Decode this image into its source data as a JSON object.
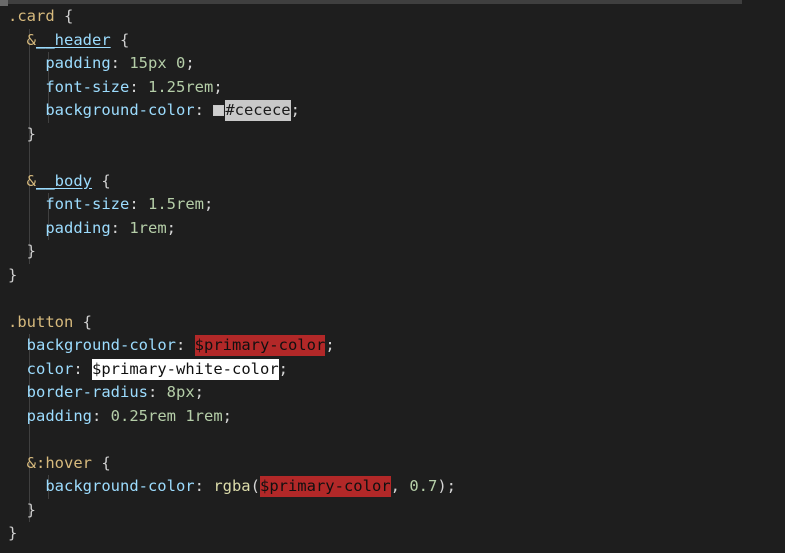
{
  "editor": {
    "language": "scss",
    "theme": "dark-plus",
    "background_color": "#1e1e1e",
    "foreground_color": "#d4d4d4",
    "scrollbar": {
      "name": "horizontal-scrollbar",
      "thumb_color": "#3f3f3f"
    }
  },
  "colors": {
    "selector": "#d7ba7d",
    "property": "#9cdcfe",
    "value": "#b5cea8",
    "function": "#dcdcaa",
    "punctuation": "#d4d4d4",
    "swatch_cecece": "#cecece",
    "highlight_gray": "#c8c8c8",
    "highlight_red": "#b22828",
    "highlight_white": "#ffffff",
    "indent_guide": "#404040"
  },
  "code": {
    "lines": [
      {
        "n": 1,
        "guides": [],
        "segments": [
          {
            "t": ".card",
            "c": "tok-selector"
          },
          {
            "t": " ",
            "c": "tok-plain"
          },
          {
            "t": "{",
            "c": "tok-brace"
          }
        ]
      },
      {
        "n": 2,
        "guides": [
          "g1"
        ],
        "segments": [
          {
            "t": "  ",
            "c": "tok-plain"
          },
          {
            "t": "&",
            "c": "tok-amp"
          },
          {
            "t": "__header",
            "c": "tok-nest"
          },
          {
            "t": " ",
            "c": "tok-plain"
          },
          {
            "t": "{",
            "c": "tok-brace"
          }
        ]
      },
      {
        "n": 3,
        "guides": [
          "g1",
          "g2"
        ],
        "segments": [
          {
            "t": "    ",
            "c": "tok-plain"
          },
          {
            "t": "padding",
            "c": "tok-prop"
          },
          {
            "t": ": ",
            "c": "tok-punct"
          },
          {
            "t": "15px",
            "c": "tok-unitnum"
          },
          {
            "t": " ",
            "c": "tok-plain"
          },
          {
            "t": "0",
            "c": "tok-num"
          },
          {
            "t": ";",
            "c": "tok-punct"
          }
        ]
      },
      {
        "n": 4,
        "guides": [
          "g1",
          "g2"
        ],
        "segments": [
          {
            "t": "    ",
            "c": "tok-plain"
          },
          {
            "t": "font-size",
            "c": "tok-prop"
          },
          {
            "t": ": ",
            "c": "tok-punct"
          },
          {
            "t": "1.25rem",
            "c": "tok-unitnum"
          },
          {
            "t": ";",
            "c": "tok-punct"
          }
        ]
      },
      {
        "n": 5,
        "guides": [
          "g1",
          "g2"
        ],
        "segments": [
          {
            "t": "    ",
            "c": "tok-plain"
          },
          {
            "t": "background-color",
            "c": "tok-prop"
          },
          {
            "t": ": ",
            "c": "tok-punct"
          },
          {
            "t": "",
            "c": "swatch-cecece"
          },
          {
            "t": "#cecece",
            "c": "hl-gray"
          },
          {
            "t": ";",
            "c": "tok-punct"
          }
        ]
      },
      {
        "n": 6,
        "guides": [
          "g1"
        ],
        "segments": [
          {
            "t": "  ",
            "c": "tok-plain"
          },
          {
            "t": "}",
            "c": "tok-brace"
          }
        ]
      },
      {
        "n": 7,
        "guides": [
          "g1"
        ],
        "segments": []
      },
      {
        "n": 8,
        "guides": [
          "g1"
        ],
        "segments": [
          {
            "t": "  ",
            "c": "tok-plain"
          },
          {
            "t": "&",
            "c": "tok-amp"
          },
          {
            "t": "__body",
            "c": "tok-nest"
          },
          {
            "t": " ",
            "c": "tok-plain"
          },
          {
            "t": "{",
            "c": "tok-brace"
          }
        ]
      },
      {
        "n": 9,
        "guides": [
          "g1",
          "g2"
        ],
        "segments": [
          {
            "t": "    ",
            "c": "tok-plain"
          },
          {
            "t": "font-size",
            "c": "tok-prop"
          },
          {
            "t": ": ",
            "c": "tok-punct"
          },
          {
            "t": "1.5rem",
            "c": "tok-unitnum"
          },
          {
            "t": ";",
            "c": "tok-punct"
          }
        ]
      },
      {
        "n": 10,
        "guides": [
          "g1",
          "g2"
        ],
        "segments": [
          {
            "t": "    ",
            "c": "tok-plain"
          },
          {
            "t": "padding",
            "c": "tok-prop"
          },
          {
            "t": ": ",
            "c": "tok-punct"
          },
          {
            "t": "1rem",
            "c": "tok-unitnum"
          },
          {
            "t": ";",
            "c": "tok-punct"
          }
        ]
      },
      {
        "n": 11,
        "guides": [
          "g1"
        ],
        "segments": [
          {
            "t": "  ",
            "c": "tok-plain"
          },
          {
            "t": "}",
            "c": "tok-brace"
          }
        ]
      },
      {
        "n": 12,
        "guides": [],
        "segments": [
          {
            "t": "}",
            "c": "tok-brace"
          }
        ]
      },
      {
        "n": 13,
        "guides": [],
        "segments": []
      },
      {
        "n": 14,
        "guides": [],
        "segments": [
          {
            "t": ".button",
            "c": "tok-selector"
          },
          {
            "t": " ",
            "c": "tok-plain"
          },
          {
            "t": "{",
            "c": "tok-brace"
          }
        ]
      },
      {
        "n": 15,
        "guides": [
          "g1"
        ],
        "segments": [
          {
            "t": "  ",
            "c": "tok-plain"
          },
          {
            "t": "background-color",
            "c": "tok-prop"
          },
          {
            "t": ": ",
            "c": "tok-punct"
          },
          {
            "t": "$primary-color",
            "c": "hl-red"
          },
          {
            "t": ";",
            "c": "tok-punct"
          }
        ]
      },
      {
        "n": 16,
        "guides": [
          "g1"
        ],
        "segments": [
          {
            "t": "  ",
            "c": "tok-plain"
          },
          {
            "t": "color",
            "c": "tok-prop"
          },
          {
            "t": ": ",
            "c": "tok-punct"
          },
          {
            "t": "$primary-white-color",
            "c": "hl-white"
          },
          {
            "t": ";",
            "c": "tok-punct"
          }
        ]
      },
      {
        "n": 17,
        "guides": [
          "g1"
        ],
        "segments": [
          {
            "t": "  ",
            "c": "tok-plain"
          },
          {
            "t": "border-radius",
            "c": "tok-prop"
          },
          {
            "t": ": ",
            "c": "tok-punct"
          },
          {
            "t": "8px",
            "c": "tok-unitnum"
          },
          {
            "t": ";",
            "c": "tok-punct"
          }
        ]
      },
      {
        "n": 18,
        "guides": [
          "g1"
        ],
        "segments": [
          {
            "t": "  ",
            "c": "tok-plain"
          },
          {
            "t": "padding",
            "c": "tok-prop"
          },
          {
            "t": ": ",
            "c": "tok-punct"
          },
          {
            "t": "0.25rem",
            "c": "tok-unitnum"
          },
          {
            "t": " ",
            "c": "tok-plain"
          },
          {
            "t": "1rem",
            "c": "tok-unitnum"
          },
          {
            "t": ";",
            "c": "tok-punct"
          }
        ]
      },
      {
        "n": 19,
        "guides": [
          "g1"
        ],
        "segments": []
      },
      {
        "n": 20,
        "guides": [
          "g1"
        ],
        "segments": [
          {
            "t": "  ",
            "c": "tok-plain"
          },
          {
            "t": "&",
            "c": "tok-amp"
          },
          {
            "t": ":hover",
            "c": "tok-pseudo"
          },
          {
            "t": " ",
            "c": "tok-plain"
          },
          {
            "t": "{",
            "c": "tok-brace"
          }
        ]
      },
      {
        "n": 21,
        "guides": [
          "g1",
          "g2"
        ],
        "segments": [
          {
            "t": "    ",
            "c": "tok-plain"
          },
          {
            "t": "background-color",
            "c": "tok-prop"
          },
          {
            "t": ": ",
            "c": "tok-punct"
          },
          {
            "t": "rgba",
            "c": "tok-func"
          },
          {
            "t": "(",
            "c": "tok-punct"
          },
          {
            "t": "$primary-color",
            "c": "hl-red"
          },
          {
            "t": ", ",
            "c": "tok-punct"
          },
          {
            "t": "0.7",
            "c": "tok-num"
          },
          {
            "t": ")",
            "c": "tok-punct"
          },
          {
            "t": ";",
            "c": "tok-punct"
          }
        ]
      },
      {
        "n": 22,
        "guides": [
          "g1"
        ],
        "segments": [
          {
            "t": "  ",
            "c": "tok-plain"
          },
          {
            "t": "}",
            "c": "tok-brace"
          }
        ]
      },
      {
        "n": 23,
        "guides": [],
        "segments": [
          {
            "t": "}",
            "c": "tok-brace"
          }
        ]
      }
    ]
  }
}
